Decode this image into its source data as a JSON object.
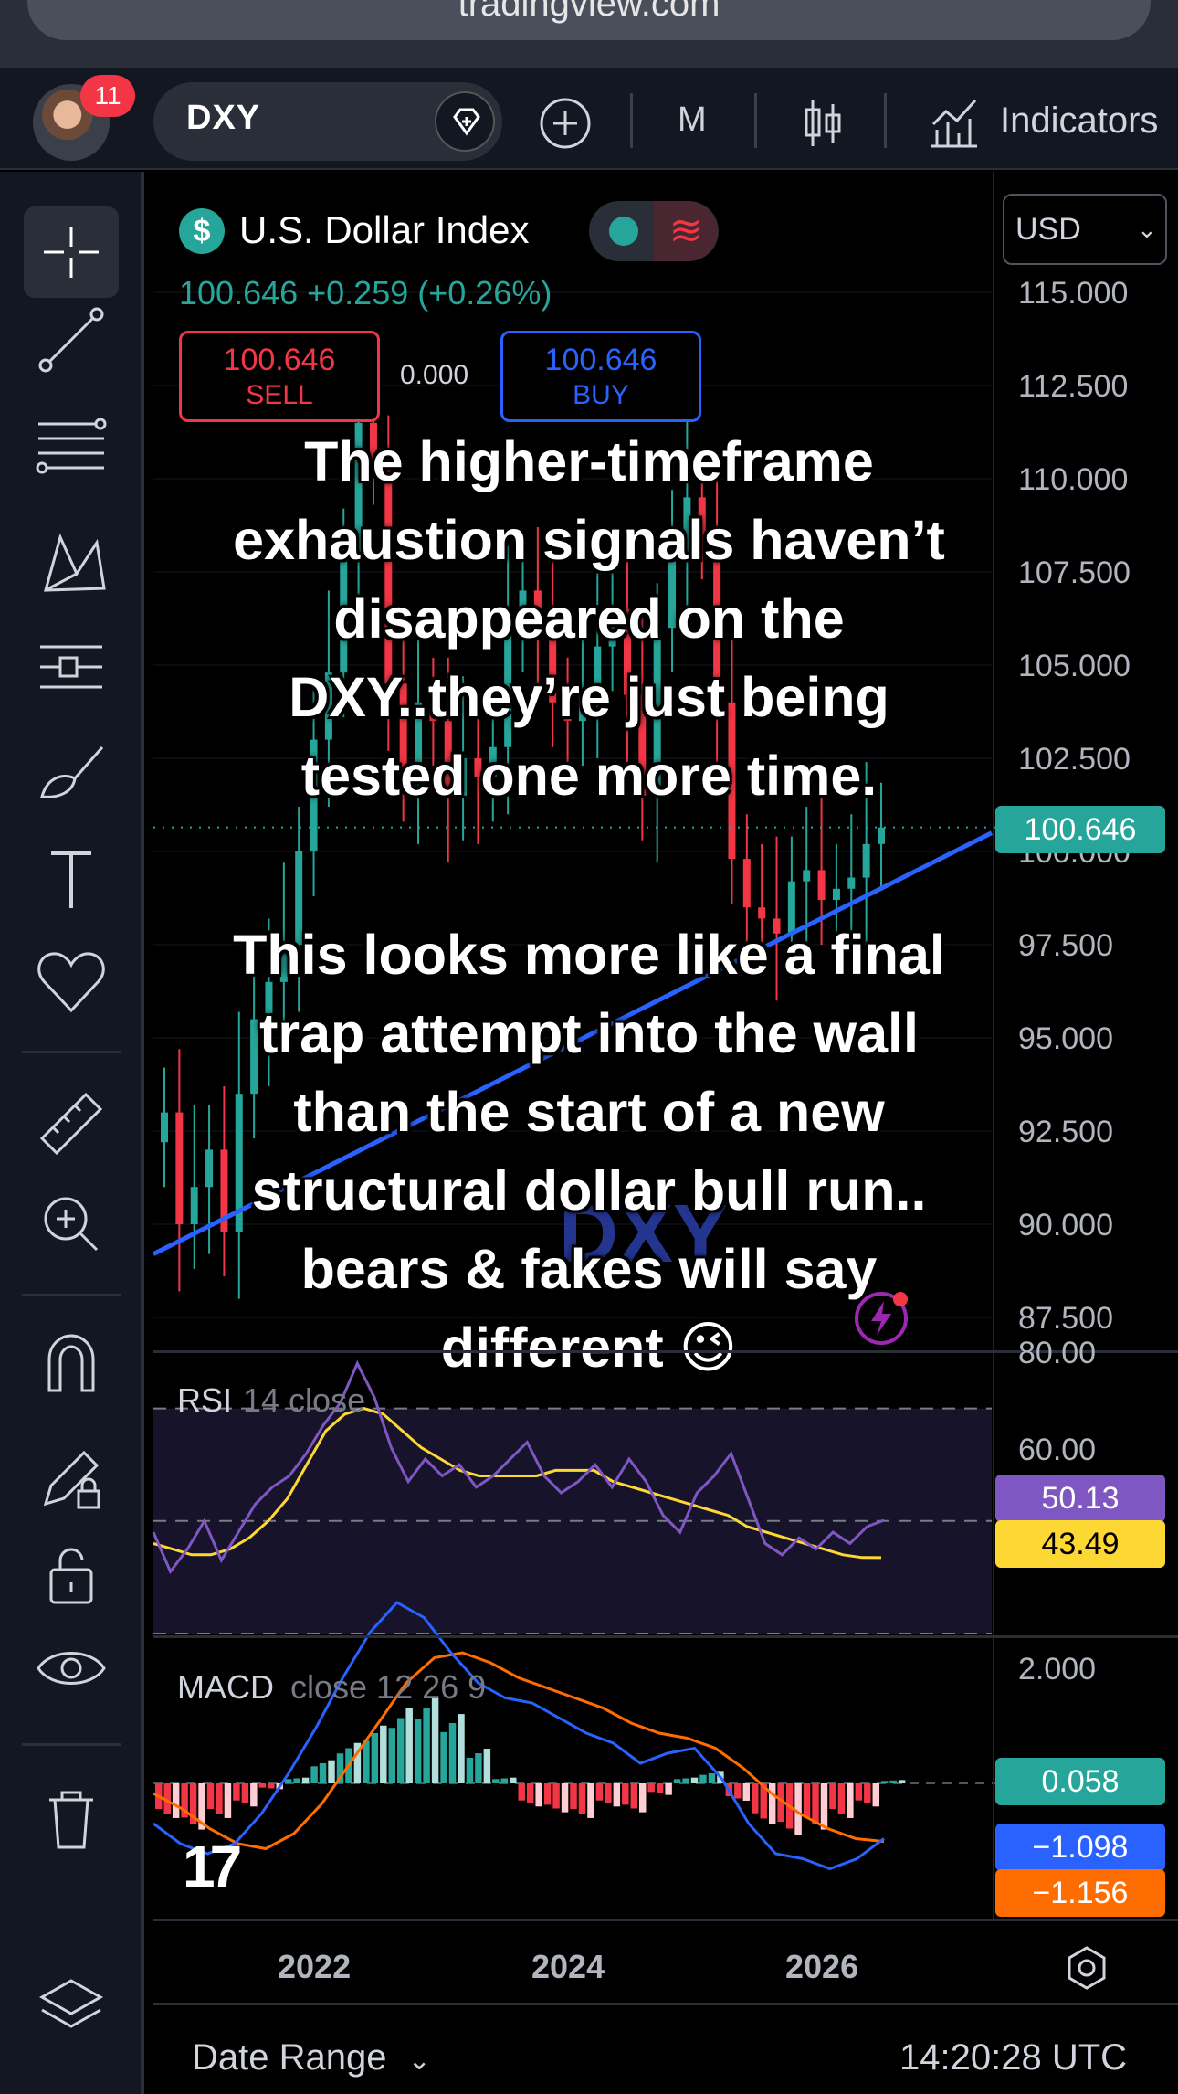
{
  "browser": {
    "url": "tradingview.com"
  },
  "toolbar": {
    "notifications": "11",
    "symbol": "DXY",
    "interval": "M",
    "indicators_label": "Indicators"
  },
  "legend": {
    "name": "U.S. Dollar Index",
    "currency_symbol": "$",
    "status_wave": "≋",
    "price_line": "100.646  +0.259 (+0.26%)",
    "sell_price": "100.646",
    "sell_label": "SELL",
    "buy_price": "100.646",
    "buy_label": "BUY",
    "spread": "0.000"
  },
  "price_scale": {
    "currency": "USD",
    "labels": [
      "115.000",
      "112.500",
      "110.000",
      "107.500",
      "105.000",
      "102.500",
      "100.000",
      "97.500",
      "95.000",
      "92.500",
      "90.000",
      "87.500"
    ],
    "last_price": "100.646"
  },
  "watermark": "DXY",
  "caption": {
    "lines_1": [
      "The higher-timeframe",
      "exhaustion signals haven’t",
      "disappeared on the",
      "DXY..they’re just being",
      "tested one more time."
    ],
    "lines_2": [
      "This looks more like a final",
      "trap attempt into the wall",
      "than the start of a new",
      "structural dollar bull run..",
      "bears & fakes will say",
      "different  😉"
    ]
  },
  "rsi": {
    "label": "RSI",
    "params": "14 close",
    "scale_top": "80.00",
    "scale_mid": "60.00",
    "value_rsi": "50.13",
    "value_ma": "43.49"
  },
  "macd": {
    "label": "MACD",
    "params": "close 12 26 9",
    "scale_top": "2.000",
    "value_hist": "0.058",
    "value_macd": "−1.098",
    "value_signal": "−1.156"
  },
  "time_axis": {
    "years": [
      "2022",
      "2024",
      "2026"
    ]
  },
  "bottom": {
    "date_range": "Date Range",
    "clock": "14:20:28 UTC"
  },
  "logo": "17",
  "colors": {
    "up": "#26a69a",
    "down": "#f23645",
    "rsi": "#7e57c2",
    "rsi_ma": "#fdd835",
    "macd": "#2962ff",
    "signal": "#ff6d00",
    "trendline": "#2962ff"
  },
  "chart_data": [
    {
      "type": "candlestick",
      "title": "U.S. Dollar Index",
      "timeframe": "M",
      "x_ticks": [
        "2022",
        "2024",
        "2026"
      ],
      "ylim": [
        87.5,
        115
      ],
      "y_ticks": [
        115,
        112.5,
        110,
        107.5,
        105,
        102.5,
        100,
        97.5,
        95,
        92.5,
        90,
        87.5
      ],
      "last": 100.646,
      "close_series": [
        93,
        90,
        91,
        92,
        89.8,
        93.5,
        95.5,
        96.5,
        97.5,
        100,
        103,
        104.8,
        108,
        111.5,
        110.5,
        104.5,
        102,
        104,
        103.5,
        101.5,
        102.5,
        102,
        102.8,
        106,
        107,
        106,
        104,
        103.5,
        104.3,
        105.5,
        106.5,
        104.2,
        101.5,
        106,
        108,
        109.5,
        108.5,
        104,
        99.8,
        98.5,
        98.2,
        97.8,
        99.2,
        99.5,
        98.7,
        99,
        99.3,
        100.2,
        100.646
      ]
    },
    {
      "type": "line",
      "title": "RSI 14 close",
      "ylim": [
        30,
        80
      ],
      "series": [
        {
          "name": "RSI",
          "values": [
            48,
            41,
            45,
            50,
            43,
            48,
            53,
            56,
            58,
            62,
            67,
            71,
            78,
            72,
            63,
            57,
            61,
            58,
            60,
            56,
            58,
            61,
            64,
            58,
            55,
            57,
            60,
            56,
            61,
            57,
            51,
            48,
            55,
            58,
            62,
            54,
            46,
            44,
            47,
            45,
            48,
            46,
            49,
            50.13
          ]
        },
        {
          "name": "MA",
          "values": [
            46,
            45,
            44,
            44,
            45,
            47,
            50,
            54,
            60,
            66,
            69,
            70,
            69,
            66,
            63,
            61,
            59,
            58,
            58,
            58,
            58,
            59,
            59,
            59,
            57,
            56,
            55,
            54,
            53,
            52,
            51,
            49,
            48,
            47,
            46,
            45,
            44,
            43.5,
            43.49
          ]
        }
      ]
    },
    {
      "type": "line",
      "title": "MACD close 12 26 9",
      "series": [
        {
          "name": "Histogram",
          "values": [
            -0.6,
            -0.8,
            -0.6,
            -0.4,
            -0.1,
            0.1,
            0.4,
            0.7,
            1.0,
            1.3,
            1.5,
            1.2,
            0.6,
            0.1,
            -0.4,
            -0.5,
            -0.6,
            -0.4,
            -0.5,
            -0.2,
            0.1,
            0.2,
            -0.3,
            -0.7,
            -0.9,
            -0.8,
            -0.6,
            -0.4,
            0.058
          ]
        },
        {
          "name": "MACD",
          "values": [
            -0.8,
            -1.2,
            -1.4,
            -1.2,
            -0.6,
            0.2,
            1.1,
            2.1,
            3.0,
            3.6,
            3.3,
            2.6,
            2.0,
            1.7,
            1.6,
            1.3,
            1.0,
            0.8,
            0.4,
            0.6,
            0.7,
            0.1,
            -0.8,
            -1.4,
            -1.5,
            -1.7,
            -1.5,
            -1.098
          ]
        },
        {
          "name": "Signal",
          "values": [
            -0.2,
            -0.5,
            -0.9,
            -1.2,
            -1.3,
            -1.0,
            -0.4,
            0.4,
            1.2,
            2.0,
            2.5,
            2.6,
            2.4,
            2.1,
            1.9,
            1.7,
            1.5,
            1.2,
            1.0,
            0.9,
            0.7,
            0.3,
            -0.2,
            -0.6,
            -0.9,
            -1.1,
            -1.156
          ]
        }
      ]
    }
  ]
}
